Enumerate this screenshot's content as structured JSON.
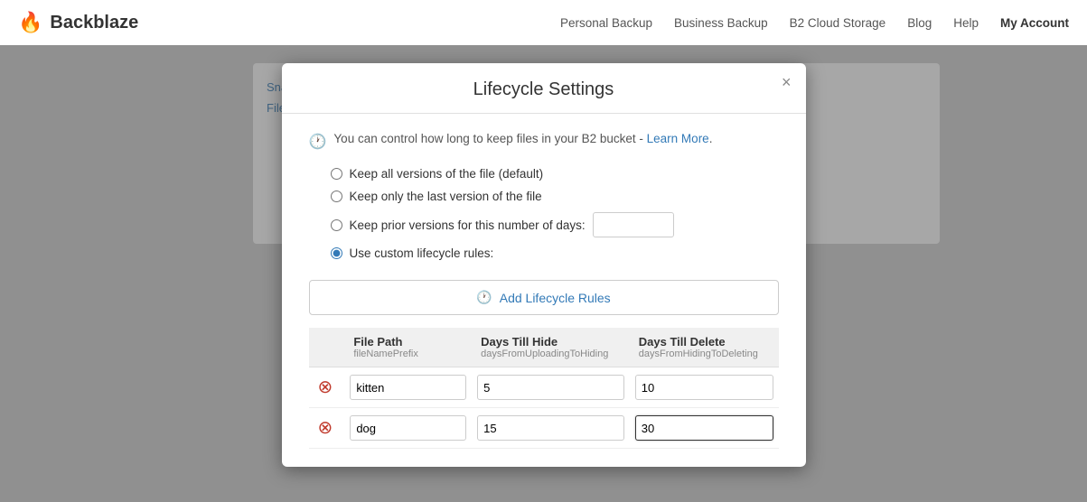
{
  "brand": {
    "name": "Backblaze",
    "flame": "🔥"
  },
  "nav": {
    "links": [
      {
        "label": "Personal Backup",
        "active": false
      },
      {
        "label": "Business Backup",
        "active": false
      },
      {
        "label": "B2 Cloud Storage",
        "active": false
      },
      {
        "label": "Blog",
        "active": false
      },
      {
        "label": "Help",
        "active": false
      },
      {
        "label": "My Account",
        "active": true
      }
    ]
  },
  "bg": {
    "items": [
      "Snapshot",
      "Files"
    ]
  },
  "modal": {
    "title": "Lifecycle Settings",
    "close_label": "×",
    "info_text": "You can control how long to keep files in your B2 bucket -",
    "learn_more": "Learn More",
    "learn_more_dot": ".",
    "radio_options": [
      {
        "id": "r1",
        "label": "Keep all versions of the file (default)",
        "checked": false
      },
      {
        "id": "r2",
        "label": "Keep only the last version of the file",
        "checked": false
      },
      {
        "id": "r3",
        "label": "Keep prior versions for this number of days:",
        "checked": false,
        "has_input": true,
        "input_value": ""
      },
      {
        "id": "r4",
        "label": "Use custom lifecycle rules:",
        "checked": true
      }
    ],
    "add_button_label": "Add Lifecycle Rules",
    "table": {
      "columns": [
        {
          "label": "File Path",
          "sub": "fileNamePrefix"
        },
        {
          "label": "Days Till Hide",
          "sub": "daysFromUploadingToHiding"
        },
        {
          "label": "Days Till Delete",
          "sub": "daysFromHidingToDeleting"
        }
      ],
      "rows": [
        {
          "path": "kitten",
          "hide": "5",
          "delete": "10"
        },
        {
          "path": "dog",
          "hide": "15",
          "delete": "30"
        }
      ]
    }
  }
}
